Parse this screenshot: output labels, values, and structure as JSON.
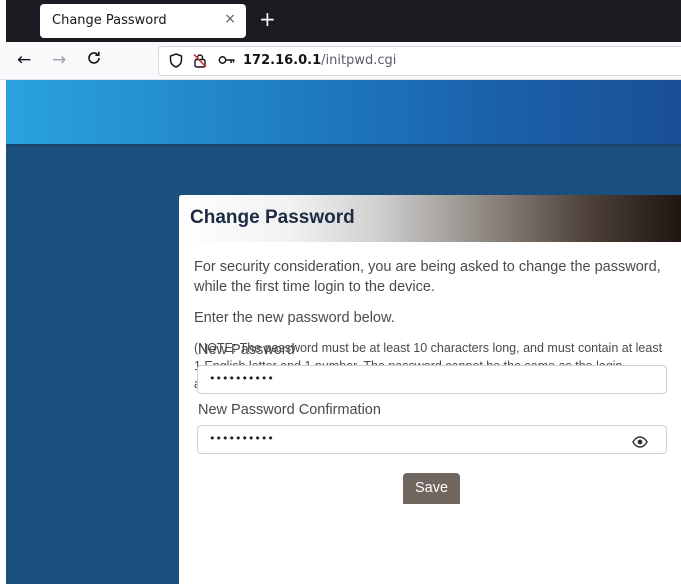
{
  "browser": {
    "tab_title": "Change Password",
    "tab_close_icon": "close-icon",
    "new_tab_icon": "plus-icon",
    "url_host": "172.16.0.1",
    "url_path": "/initpwd.cgi"
  },
  "page": {
    "title": "Change Password",
    "intro": "For security consideration, you are being asked to change the password, while the first time login to the device.",
    "instruction": "Enter the new password below.",
    "note": "(NOTE: The password must be at least 10 characters long, and must contain at least 1 English letter and 1 number. The password cannot be the same as the login account.)",
    "new_password_label": "New Password",
    "new_password_value": "••••••••••",
    "confirm_label": "New Password Confirmation",
    "confirm_value": "••••••••••",
    "save_label": "Save"
  },
  "colors": {
    "header_band": "#2aa3df",
    "page_background": "#1b4f7d",
    "save_button": "#6f6660",
    "title_text": "#1d2b44"
  }
}
